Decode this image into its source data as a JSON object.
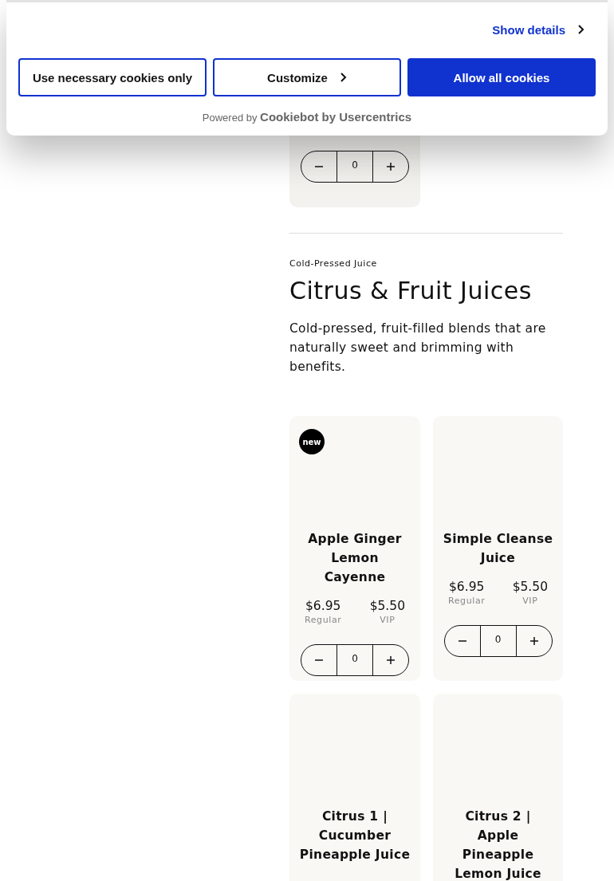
{
  "top_card": {
    "quantity": "0"
  },
  "section": {
    "eyebrow": "Cold-Pressed Juice",
    "title": "Citrus & Fruit Juices",
    "description": "Cold-pressed, fruit-filled blends that are naturally sweet and brimming with benefits."
  },
  "products": [
    {
      "name": "Apple Ginger Lemon Cayenne",
      "badge": "new",
      "regular_price": "$6.95",
      "regular_label": "Regular",
      "vip_price": "$5.50",
      "vip_label": "VIP",
      "quantity": "0"
    },
    {
      "name": "Simple Cleanse Juice",
      "regular_price": "$6.95",
      "regular_label": "Regular",
      "vip_price": "$5.50",
      "vip_label": "VIP",
      "quantity": "0"
    },
    {
      "name": "Citrus 1 | Cucumber Pineapple Juice"
    },
    {
      "name": "Citrus 2 | Apple Pineapple Lemon Juice"
    }
  ],
  "cookie_banner": {
    "details_link": "Show details",
    "buttons": [
      {
        "label": "Use necessary cookies only",
        "kind": "outline"
      },
      {
        "label": "Customize",
        "kind": "outline-chevron"
      },
      {
        "label": "Allow all cookies",
        "kind": "primary"
      }
    ],
    "powered_by": "Powered by",
    "brand": "Cookiebot by Usercentrics"
  }
}
